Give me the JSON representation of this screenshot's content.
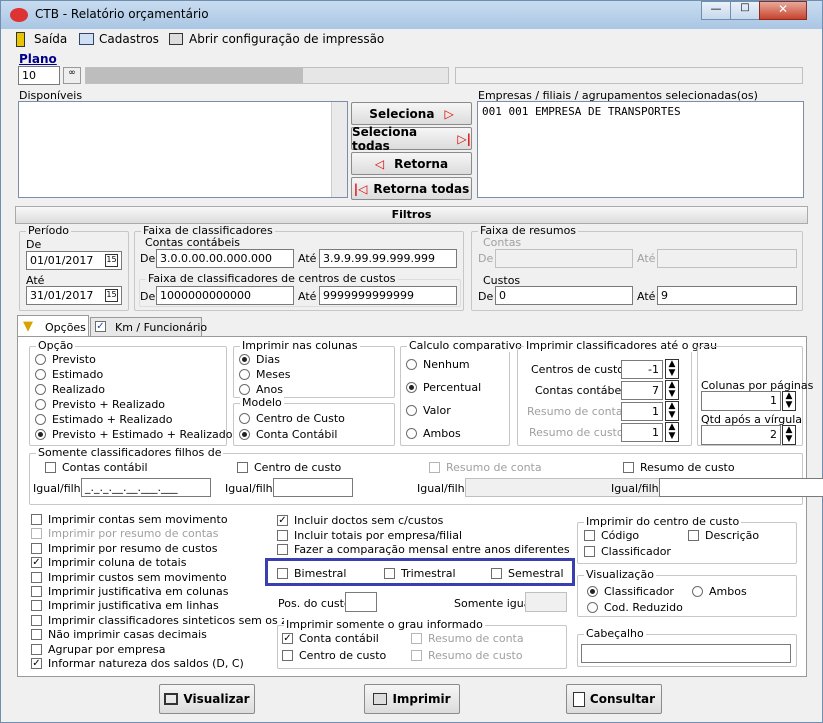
{
  "window": {
    "title": "CTB - Relatório orçamentário"
  },
  "menu": {
    "exit": "Saída",
    "registers": "Cadastros",
    "print_config": "Abrir configuração de impressão"
  },
  "plano": {
    "label": "Plano",
    "value": "10"
  },
  "available": {
    "label": "Disponíveis"
  },
  "selected": {
    "label": "Empresas / filiais / agrupamentos selecionadas(os)",
    "items": [
      "001 001 EMPRESA DE TRANSPORTES"
    ]
  },
  "transfer": {
    "select": "Seleciona",
    "select_all": "Seleciona todas",
    "return": "Retorna",
    "return_all": "Retorna todas"
  },
  "filters": {
    "title": "Filtros",
    "period": {
      "label": "Período",
      "from_label": "De",
      "from": "01/01/2017",
      "to_label": "Até",
      "to": "31/01/2017"
    },
    "class_range": {
      "label": "Faixa de classificadores",
      "accounts_label": "Contas contábeis",
      "from_label": "De",
      "from": "3.0.0.00.00.000.000",
      "to_label": "Até",
      "to": "3.9.9.99.99.999.999",
      "cc_label": "Faixa de classificadores de centros de custos",
      "cc_from": "1000000000000",
      "cc_to": "9999999999999"
    },
    "summary_range": {
      "label": "Faixa de resumos",
      "accounts_label": "Contas",
      "from_label": "De",
      "to_label": "Até",
      "costs_label": "Custos",
      "costs_from": "0",
      "costs_to": "9"
    }
  },
  "tabs": {
    "options": "Opções",
    "km": "Km / Funcionário"
  },
  "opcao": {
    "label": "Opção",
    "items": [
      "Previsto",
      "Estimado",
      "Realizado",
      "Previsto + Realizado",
      "Estimado + Realizado",
      "Previsto + Estimado + Realizado"
    ]
  },
  "columns": {
    "label": "Imprimir nas colunas",
    "items": [
      "Dias",
      "Meses",
      "Anos"
    ]
  },
  "modelo": {
    "label": "Modelo",
    "items": [
      "Centro de Custo",
      "Conta Contábil"
    ]
  },
  "comparativo": {
    "label": "Calculo comparativo",
    "items": [
      "Nenhum",
      "Percentual",
      "Valor",
      "Ambos"
    ]
  },
  "grau": {
    "label": "Imprimir classificadores até o grau",
    "rows": [
      {
        "label": "Centros de custos",
        "value": "-1"
      },
      {
        "label": "Contas contábeis",
        "value": "7"
      },
      {
        "label": "Resumo de contas",
        "value": "1"
      },
      {
        "label": "Resumo de custos",
        "value": "1"
      }
    ]
  },
  "pages": {
    "cols_label": "Colunas por páginas",
    "cols": "1",
    "dec_label": "Qtd após a vírgula",
    "dec": "2"
  },
  "children": {
    "label": "Somente classificadores filhos de",
    "items": [
      "Contas contábil",
      "Centro de custo",
      "Resumo de conta",
      "Resumo de custo"
    ],
    "eq_label": "Igual/filho",
    "mask": "_._._.__.__.___.___"
  },
  "left_checks": [
    "Imprimir contas sem movimento",
    "Imprimir por resumo de contas",
    "Imprimir por resumo de custos",
    "Imprimir coluna de totais",
    "Imprimir custos sem movimento",
    "Imprimir justificativa em colunas",
    "Imprimir justificativa em linhas",
    "Imprimir classificadores sinteticos sem os zeros",
    "Não imprimir casas decimais",
    "Agrupar por empresa",
    "Informar natureza dos saldos (D, C)"
  ],
  "mid_checks": [
    "Incluir doctos sem c/custos",
    "Incluir totais por empresa/filial",
    "Fazer a comparação mensal entre anos diferentes"
  ],
  "periodic": [
    "Bimestral",
    "Trimestral",
    "Semestral"
  ],
  "pos_custo": "Pos. do custo",
  "somente_igual": "Somente igual",
  "grau_only": {
    "label": "Imprimir somente o grau informado",
    "items": [
      "Conta contábil",
      "Resumo de conta",
      "Centro de custo",
      "Resumo de custo"
    ]
  },
  "cc_print": {
    "label": "Imprimir do centro de custo",
    "items": [
      "Código",
      "Descrição",
      "Classificador"
    ]
  },
  "visual": {
    "label": "Visualização",
    "items": [
      "Classificador",
      "Ambos",
      "Cod. Reduzido"
    ]
  },
  "header": {
    "label": "Cabeçalho"
  },
  "actions": {
    "view": "Visualizar",
    "print": "Imprimir",
    "query": "Consultar"
  }
}
